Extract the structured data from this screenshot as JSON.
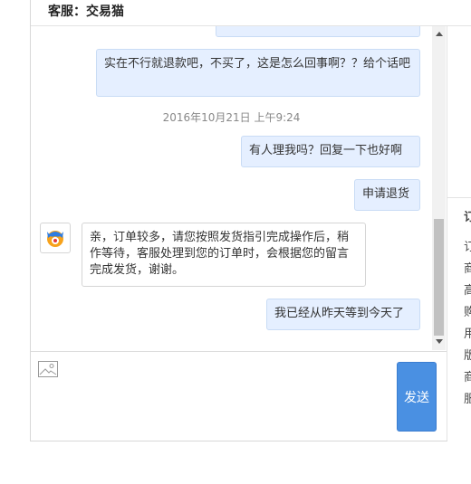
{
  "header": {
    "title": "客服：交易猫"
  },
  "messages": [
    {
      "text": "实在不行就退款吧，不买了，这是怎么回事啊？？给个话吧"
    },
    {
      "text": "2016年10月21日 上午9:24"
    },
    {
      "text": "有人理我吗？回复一下也好啊"
    },
    {
      "text": "申请退货"
    },
    {
      "text": "亲，订单较多，请您按照发货指引完成操作后，稍作等待，客服处理到您的订单时，会根据您的留言完成发货，谢谢。"
    },
    {
      "text": "我已经从昨天等到今天了"
    }
  ],
  "composer": {
    "send_label": "发送",
    "image_icon": "image-icon"
  },
  "right_panel": {
    "chars": [
      "订",
      "订",
      "商",
      "高",
      "购",
      "用",
      "版",
      "商",
      "服"
    ]
  },
  "colors": {
    "me_bubble": "#e5efff",
    "send_button": "#4a90e2",
    "agent_avatar_orange": "#f7a21b",
    "agent_avatar_blue": "#2f7de1"
  }
}
